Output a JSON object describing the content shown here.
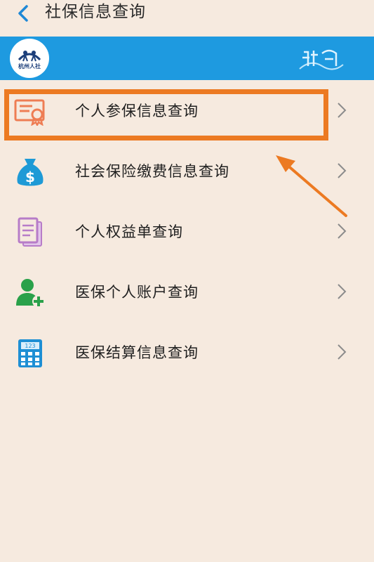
{
  "header": {
    "title": "社保信息查询",
    "back_icon": "chevron-left-icon"
  },
  "banner": {
    "logo_text": "杭州人社",
    "background_color": "#1e9ae0"
  },
  "menu": {
    "items": [
      {
        "label": "个人参保信息查询",
        "icon": "certificate-icon"
      },
      {
        "label": "社会保险缴费信息查询",
        "icon": "money-bag-icon"
      },
      {
        "label": "个人权益单查询",
        "icon": "document-copy-icon"
      },
      {
        "label": "医保个人账户查询",
        "icon": "user-add-icon"
      },
      {
        "label": "医保结算信息查询",
        "icon": "calculator-icon"
      }
    ]
  },
  "annotation": {
    "highlight_color": "#ec7a22"
  }
}
